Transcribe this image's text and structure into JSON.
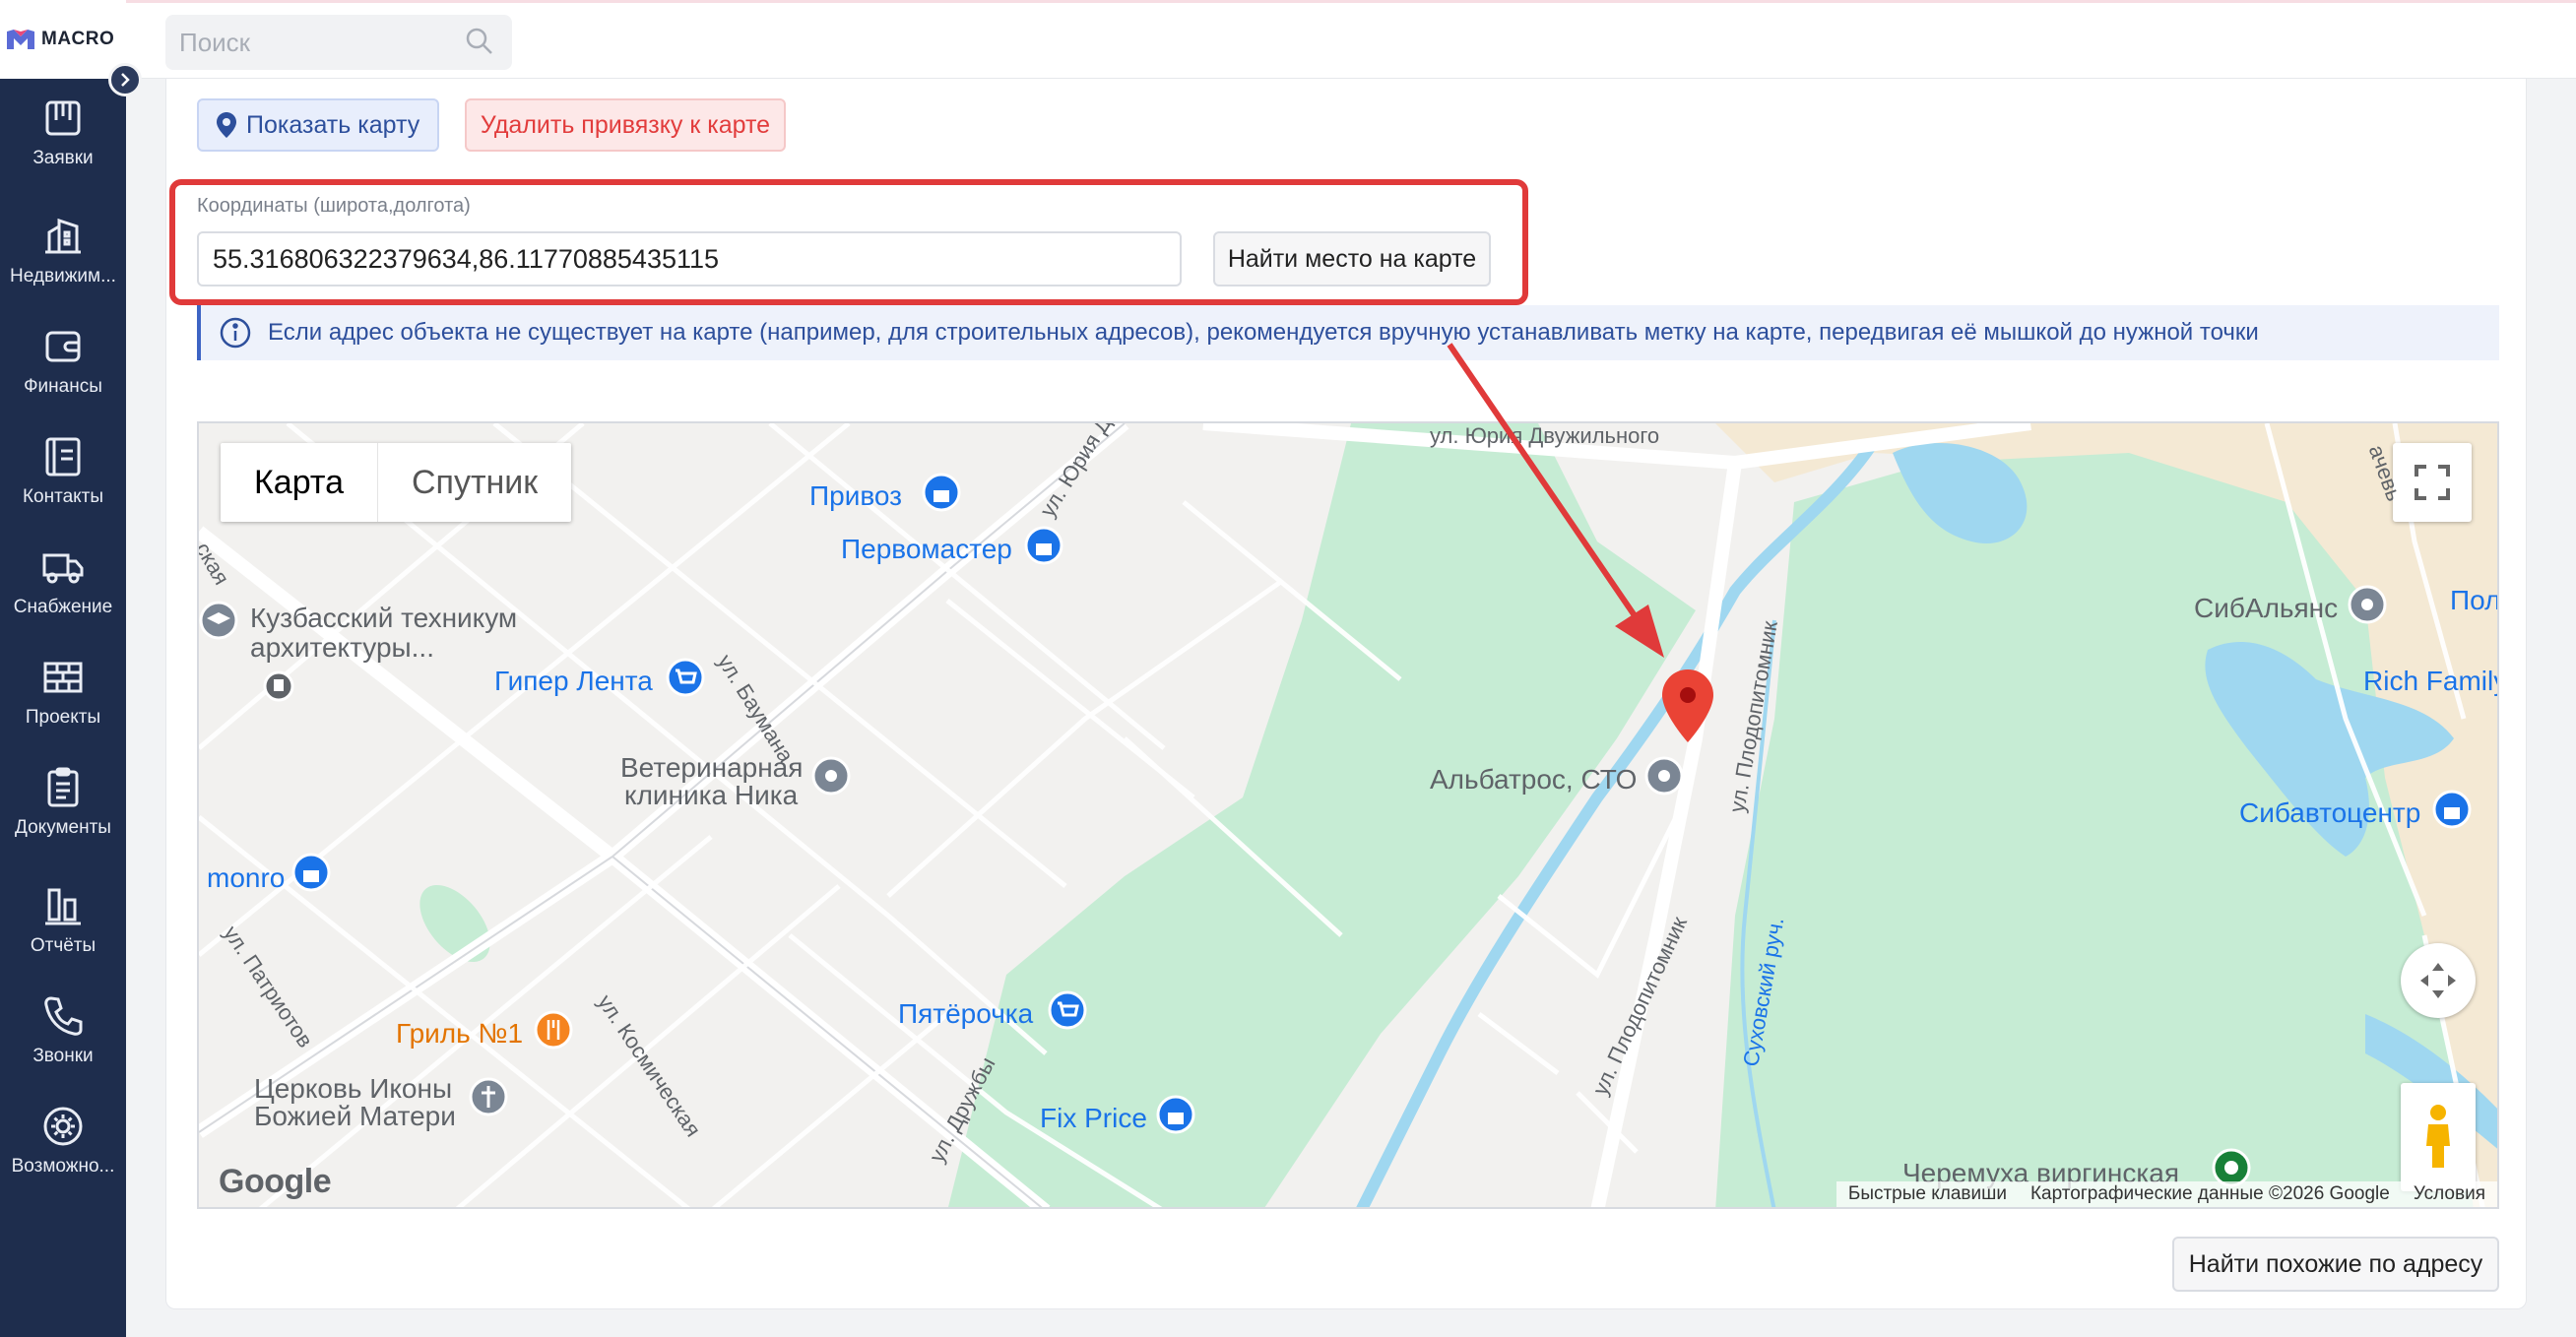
{
  "app": {
    "logo_text": "MACRO"
  },
  "search": {
    "placeholder": "Поиск"
  },
  "sidebar": {
    "items": [
      {
        "label": "Заявки",
        "icon": "requests-icon"
      },
      {
        "label": "Недвижим...",
        "icon": "building-icon"
      },
      {
        "label": "Финансы",
        "icon": "wallet-icon"
      },
      {
        "label": "Контакты",
        "icon": "contacts-icon"
      },
      {
        "label": "Снабжение",
        "icon": "truck-icon"
      },
      {
        "label": "Проекты",
        "icon": "brick-wall-icon"
      },
      {
        "label": "Документы",
        "icon": "clipboard-icon"
      },
      {
        "label": "Отчёты",
        "icon": "bar-chart-icon"
      },
      {
        "label": "Звонки",
        "icon": "phone-icon"
      },
      {
        "label": "Возможно...",
        "icon": "gear-icon"
      }
    ]
  },
  "actions": {
    "show_map": "Показать карту",
    "unlink_map": "Удалить привязку к карте"
  },
  "coordinates": {
    "label": "Координаты (широта,долгота)",
    "value": "55.316806322379634,86.11770885435115",
    "find_button": "Найти место на карте"
  },
  "info": {
    "text": "Если адрес объекта не существует на карте (например, для строительных адресов), рекомендуется вручную устанавливать метку на карте, передвигая её мышкой до нужной точки"
  },
  "map": {
    "tabs": [
      "Карта",
      "Спутник"
    ],
    "pois": {
      "privoz": "Привоз",
      "pervomaster": "Первомастер",
      "kuzbass_1": "Кузбасский техникум",
      "kuzbass_2": "архитектуры...",
      "giper_lenta": "Гипер Лента",
      "vet_1": "Ветеринарная",
      "vet_2": "клиника Ника",
      "albatros": "Альбатрос, СТО",
      "monro": "monro",
      "pyaterochka": "Пятёрочка",
      "fix_price": "Fix Price",
      "gril": "Гриль №1",
      "church_1": "Церковь Иконы",
      "church_2": "Божией Матери",
      "sibalyans": "СибАльянс",
      "rich_family": "Rich Family",
      "pol": "Пол",
      "sibavtocentr": "Сибавтоцентр",
      "cheremukha": "Черемуха виргинская"
    },
    "streets": {
      "yuria_dvuzh": "ул. Юрия Двужильного",
      "yuria": "ул. Юрия Д",
      "baumana": "ул. Баумана",
      "plodopitomnik_1": "ул. Плодопитомник",
      "plodopitomnik_2": "ул. Плодопитомник",
      "sukhovsky": "Суховский руч.",
      "patriotov": "ул. Патриотов",
      "kosmicheskaya": "ул. Космическая",
      "druzhby": "ул. Дружбы",
      "skaya": "ская",
      "cheva": "ачевь"
    },
    "attribution": [
      "Быстрые клавиши",
      "Картографические данные ©2026 Google",
      "Условия"
    ],
    "google_logo": "Google"
  },
  "footer": {
    "similar_button": "Найти похожие по адресу"
  },
  "colors": {
    "sidebar": "#1e2d4d",
    "highlight": "#e03a3a",
    "park": "#c6ecd4",
    "water": "#9fd7f0",
    "pin": "#ea4335"
  }
}
